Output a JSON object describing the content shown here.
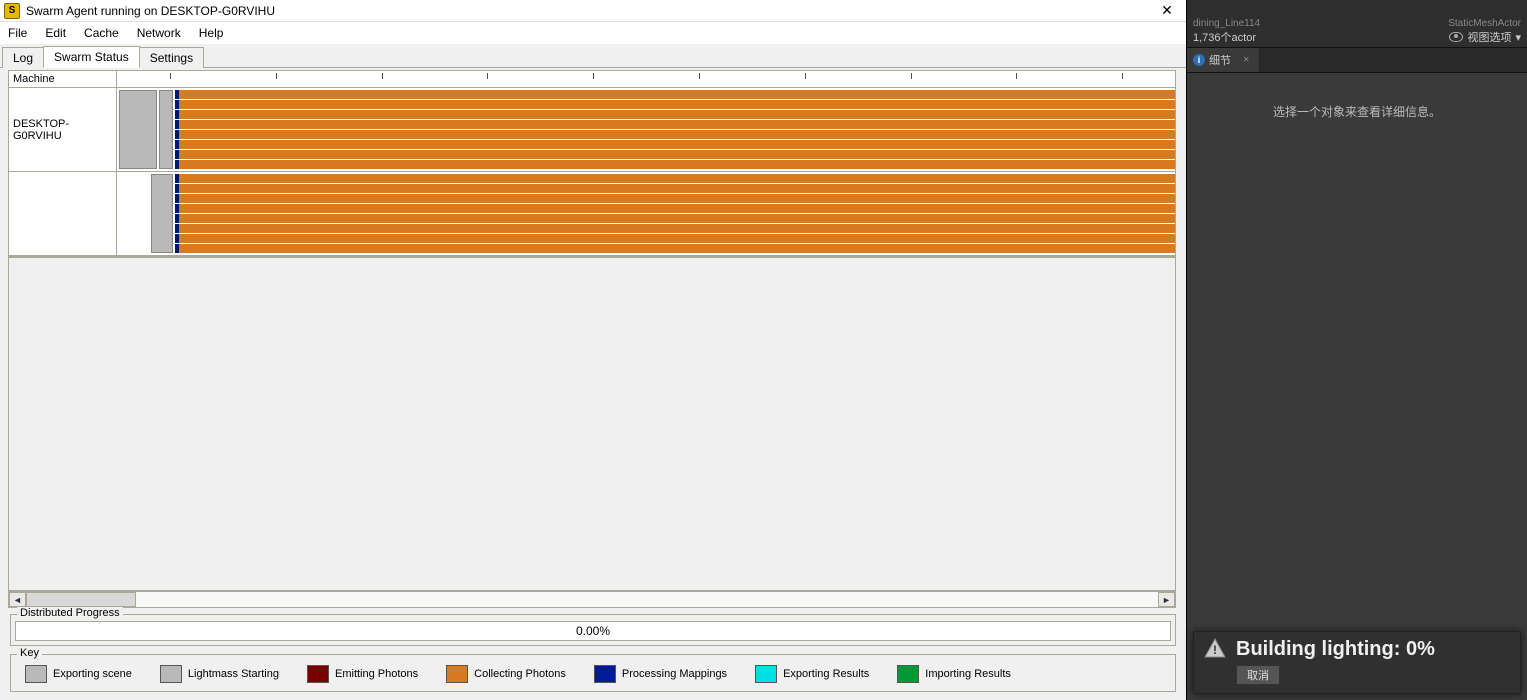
{
  "window": {
    "title": "Swarm Agent running on DESKTOP-G0RVIHU",
    "close_glyph": "✕"
  },
  "menu": {
    "file": "File",
    "edit": "Edit",
    "cache": "Cache",
    "network": "Network",
    "help": "Help"
  },
  "tabs": {
    "log": "Log",
    "swarm_status": "Swarm Status",
    "settings": "Settings"
  },
  "grid": {
    "machine_header": "Machine",
    "rows": [
      {
        "label": "DESKTOP-G0RVIHU"
      },
      {
        "label": ""
      }
    ]
  },
  "progress": {
    "legend": "Distributed Progress",
    "value": "0.00%"
  },
  "key": {
    "legend": "Key",
    "items": [
      {
        "color": "#b9b9b9",
        "label": "Exporting scene"
      },
      {
        "color": "#b9b9b9",
        "label": "Lightmass Starting"
      },
      {
        "color": "#7a0000",
        "label": "Emitting Photons"
      },
      {
        "color": "#d87a1f",
        "label": "Collecting Photons"
      },
      {
        "color": "#001a99",
        "label": "Processing Mappings"
      },
      {
        "color": "#00e0e0",
        "label": "Exporting Results"
      },
      {
        "color": "#009933",
        "label": "Importing Results"
      }
    ]
  },
  "right": {
    "faded1": "dining_Line114",
    "faded2": "StaticMeshActor",
    "actor_count": "1,736个actor",
    "view_options": "视图选项",
    "details_tab": "细节",
    "empty_msg": "选择一个对象来查看详细信息。"
  },
  "toast": {
    "title": "Building lighting:  0%",
    "cancel": "取消"
  },
  "colors": {
    "orange": "#d87a1f",
    "navy": "#001a66",
    "grey": "#b9b9b9"
  }
}
